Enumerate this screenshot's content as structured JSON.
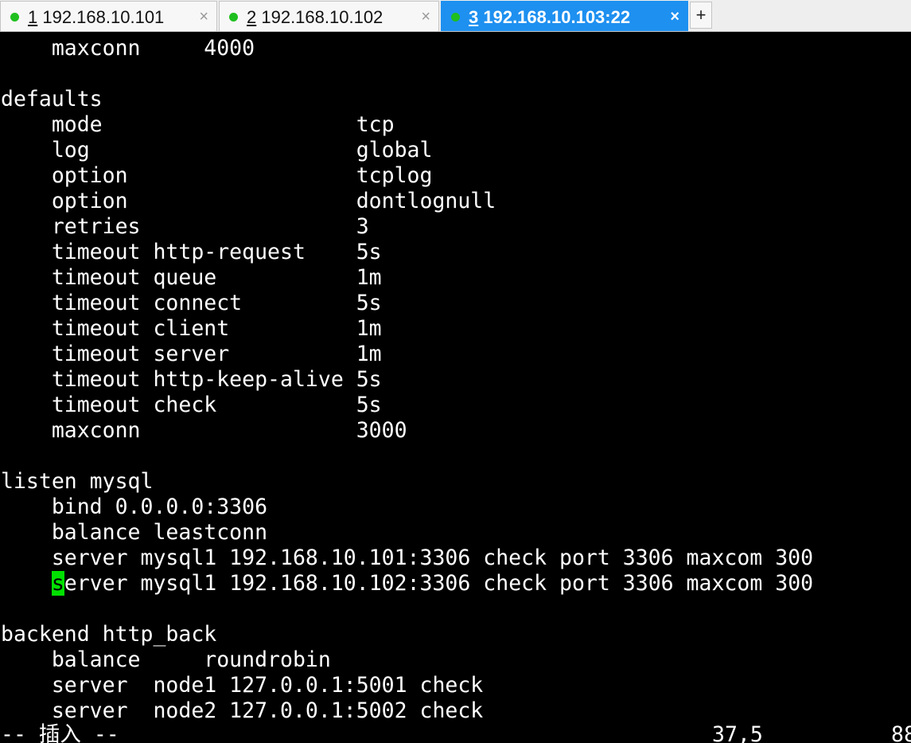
{
  "tabs": [
    {
      "num": "1",
      "title": " 192.168.10.101",
      "active": false
    },
    {
      "num": "2",
      "title": " 192.168.10.102",
      "active": false
    },
    {
      "num": "3",
      "title": " 192.168.10.103:22",
      "active": true
    }
  ],
  "tab_close_glyph": "×",
  "new_tab_glyph": "+",
  "status_dot_color": "#1fbf1f",
  "active_tab_color": "#1e90f0",
  "cursor_color": "#00e000",
  "terminal": {
    "lines": [
      "    maxconn     4000",
      "",
      "defaults",
      "    mode                    tcp",
      "    log                     global",
      "    option                  tcplog",
      "    option                  dontlognull",
      "    retries                 3",
      "    timeout http-request    5s",
      "    timeout queue           1m",
      "    timeout connect         5s",
      "    timeout client          1m",
      "    timeout server          1m",
      "    timeout http-keep-alive 5s",
      "    timeout check           5s",
      "    maxconn                 3000",
      "",
      "listen mysql",
      "    bind 0.0.0.0:3306",
      "    balance leastconn",
      "    server mysql1 192.168.10.101:3306 check port 3306 maxcom 300",
      "    server mysql1 192.168.10.102:3306 check port 3306 maxcom 300",
      "",
      "backend http_back",
      "    balance     roundrobin",
      "    server  node1 127.0.0.1:5001 check",
      "    server  node2 127.0.0.1:5002 check"
    ],
    "cursor_line": 21,
    "cursor_col": 4
  },
  "status": {
    "mode": "-- 插入 --",
    "position": "37,5",
    "percent": "88"
  }
}
